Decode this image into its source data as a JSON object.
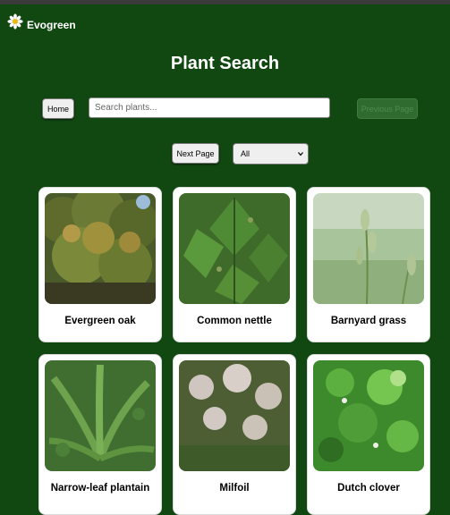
{
  "app": {
    "name": "Evogreen",
    "logo_icon": "daisy-icon"
  },
  "page": {
    "title": "Plant Search"
  },
  "controls": {
    "home_label": "Home",
    "search_placeholder": "Search plants...",
    "prev_label": "Previous Page",
    "next_label": "Next Page",
    "filter_selected": "All"
  },
  "plants": [
    {
      "name": "Evergreen oak"
    },
    {
      "name": "Common nettle"
    },
    {
      "name": "Barnyard grass"
    },
    {
      "name": "Narrow-leaf plantain"
    },
    {
      "name": "Milfoil"
    },
    {
      "name": "Dutch clover"
    }
  ],
  "colors": {
    "background": "#114811",
    "card": "#ffffff",
    "disabled_button": "#2f6a2f"
  }
}
